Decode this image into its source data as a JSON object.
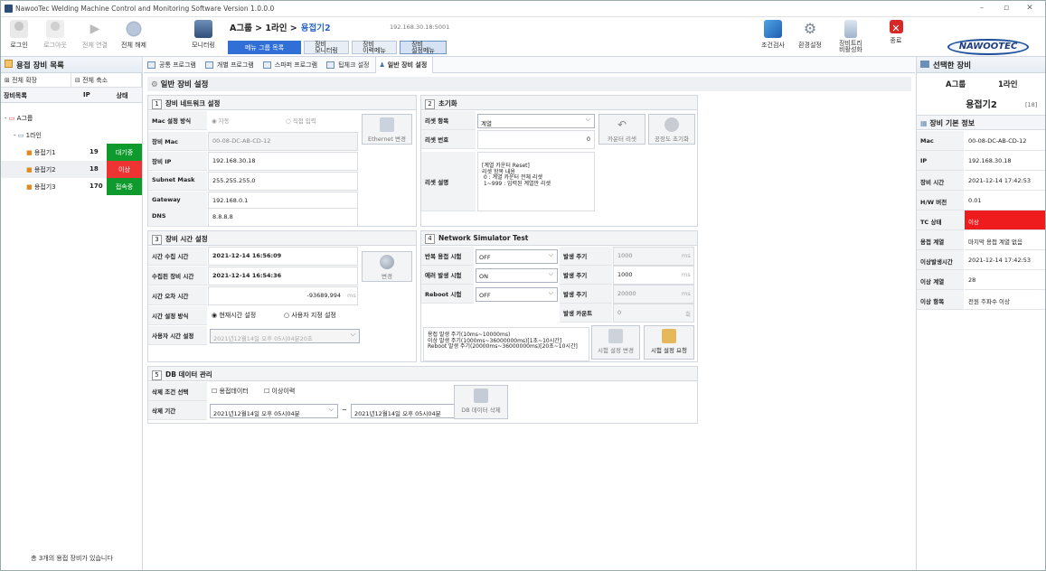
{
  "window": {
    "title": "NawooTec Welding Machine Control and Monitoring Software Version 1.0.0.0"
  },
  "toolbar": {
    "login": "로그인",
    "logout": "로그아웃",
    "connect_all": "전체 연결",
    "disconnect_all": "전체 해제",
    "monitoring": "모니터링",
    "breadcrumb": "A그룹 > 1라인 >",
    "current": "용접기2",
    "ip": "192.168.30.18:5001",
    "menu_group_list": "메뉴 그룹 목록",
    "equip_monitoring": "장비\n모니터링",
    "equip_history": "장비\n이력메뉴",
    "equip_settings": "장비\n설정메뉴",
    "condition_check": "조건검사",
    "env_settings": "환경설정",
    "equip_compare": "장비트리\n비활성화",
    "exit": "종료",
    "logo": "NAWOOTEC"
  },
  "left": {
    "title": "용접 장비 목록",
    "expand_all": "전체 확장",
    "collapse_all": "전체 축소",
    "headers": [
      "장비목록",
      "IP",
      "상태"
    ],
    "group": "A그룹",
    "line": "1라인",
    "rows": [
      {
        "name": "용접기1",
        "ip": "19",
        "status": "대기중",
        "color": "#0f9a2e"
      },
      {
        "name": "용접기2",
        "ip": "18",
        "status": "이상",
        "color": "#ee3333"
      },
      {
        "name": "용접기3",
        "ip": "170",
        "status": "접속중",
        "color": "#0f9a2e"
      }
    ],
    "footer": "총 3개의 용접 장비가 있습니다"
  },
  "tabs": [
    "공통 프로그램",
    "개별 프로그램",
    "스파퍼 프로그램",
    "팁체크 설정",
    "일반 장비 설정"
  ],
  "page_title": "일반 장비 설정",
  "s1": {
    "num": "1",
    "title": "장비 네트워크 설정",
    "mac_mode_label": "Mac 설정 방식",
    "auto": "자동",
    "manual": "직접 입력",
    "mac_label": "장비 Mac",
    "mac": "00-08-DC-AB-CD-12",
    "ip_label": "장비 IP",
    "ip": "192.168.30.18",
    "subnet_label": "Subnet Mask",
    "subnet": "255.255.255.0",
    "gw_label": "Gateway",
    "gw": "192.168.0.1",
    "dns_label": "DNS",
    "dns": "8.8.8.8",
    "eth_btn": "Ethernet 변경"
  },
  "s2": {
    "num": "2",
    "title": "초기화",
    "reset_item_label": "리셋 항목",
    "reset_item": "계열",
    "reset_no_label": "리셋 번호",
    "reset_no": "0",
    "counter_reset": "카운터 리셋",
    "factory_reset": "공장도 초기화",
    "reset_desc_label": "리셋 설명",
    "desc": "[계열 카운터 Reset]\n리셋 항목 내용\n 0 : 계열 카운터 전체 리셋\n 1~999 : 입력된 계열만 리셋"
  },
  "s3": {
    "num": "3",
    "title": "장비 시간 설정",
    "collect_label": "시간 수집 시간",
    "collect": "2021-12-14 16:56:09",
    "device_label": "수집된 장비 시간",
    "device": "2021-12-14 16:54:36",
    "err_label": "시간 오차 시간",
    "err": "-93689,994",
    "err_unit": "ms",
    "mode_label": "시간 설정 방식",
    "mode_cur": "현재시간 설정",
    "mode_user": "사용자 지정 설정",
    "user_label": "사용자 시간 설정",
    "user_time": "2021년12월14일 오후 05시04분20초",
    "change_btn": "변경"
  },
  "s4": {
    "num": "4",
    "title": "Network Simulator Test",
    "weld_label": "반복 용접 시험",
    "weld": "OFF",
    "err_label": "에러 발생 시험",
    "err": "ON",
    "reboot_label": "Reboot 시험",
    "reboot": "OFF",
    "period_label": "발생 주기",
    "p1": "1000",
    "p2": "1000",
    "p3": "20000",
    "unit": "ms",
    "count_label": "발생 카운트",
    "count": "0",
    "count_unit": "회",
    "note": "용접 발생 주기(10ms~10000ms)\n이상 발생 주기(1000ms~36000000ms)[1초~10시간]\nReboot 발생 주기(20000ms~36000000ms)[20초~10시간]",
    "test_change": "시험 설정 변경",
    "test_request": "시험 설정 요청"
  },
  "s5": {
    "num": "5",
    "title": "DB 데이터 관리",
    "cond_label": "삭제 조건 선택",
    "weld_data": "용접데이터",
    "err_hist": "이상이력",
    "period_label": "삭제 기간",
    "from": "2021년12월14일 오후 05시04분",
    "tilde": "~",
    "to": "2021년12월14일 오후 05시04분",
    "delete_btn": "DB 데이터 삭제"
  },
  "right": {
    "title": "선택한 장비",
    "group": "A그룹",
    "line": "1라인",
    "name": "용접기2",
    "badge": "[18]",
    "info_title": "장비 기본 정보",
    "rows": [
      {
        "k": "Mac",
        "v": "00-08-DC-AB-CD-12"
      },
      {
        "k": "IP",
        "v": "192.168.30.18"
      },
      {
        "k": "장비 시간",
        "v": "2021-12-14  17:42:53"
      },
      {
        "k": "H/W 버전",
        "v": "0.01"
      },
      {
        "k": "TC 상태",
        "v": "이상"
      },
      {
        "k": "용접 계열",
        "v": "마지막 용접 계열 없음"
      },
      {
        "k": "이상발생시간",
        "v": "2021-12-14  17:42:53"
      },
      {
        "k": "이상 계열",
        "v": "28"
      },
      {
        "k": "이상 항목",
        "v": "전원 주파수 이상"
      }
    ]
  },
  "colors": {
    "accent": "#2f6fd6",
    "error": "#ee1c1c",
    "ok": "#0f9a2e"
  }
}
